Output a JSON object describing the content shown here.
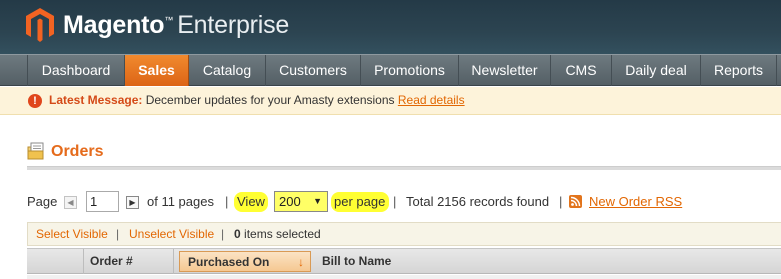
{
  "header": {
    "brand": "Magento",
    "trademark": "™",
    "edition": "Enterprise",
    "logo_icon": "magento-logo-icon"
  },
  "nav": {
    "items": [
      {
        "label": "Dashboard",
        "active": false
      },
      {
        "label": "Sales",
        "active": true
      },
      {
        "label": "Catalog",
        "active": false
      },
      {
        "label": "Customers",
        "active": false
      },
      {
        "label": "Promotions",
        "active": false
      },
      {
        "label": "Newsletter",
        "active": false
      },
      {
        "label": "CMS",
        "active": false
      },
      {
        "label": "Daily deal",
        "active": false
      },
      {
        "label": "Reports",
        "active": false
      }
    ],
    "active_color": "#e8731f"
  },
  "message": {
    "icon": "alert-icon",
    "label": "Latest Message:",
    "text": "December updates for your Amasty extensions",
    "link": "Read details"
  },
  "page": {
    "title": "Orders",
    "title_icon": "orders-icon",
    "title_color": "#e56b1c"
  },
  "pager": {
    "page_label": "Page",
    "prev_icon": "prev-arrow-icon",
    "current_page": "1",
    "next_icon": "next-arrow-icon",
    "of_pages": "of 11 pages",
    "separator": "|",
    "view_label": "View",
    "per_page_value": "200",
    "per_page_label": "per page",
    "total_records": "Total 2156 records found",
    "rss_icon": "rss-icon",
    "rss_link": "New Order RSS",
    "highlight_color": "#ffff33"
  },
  "massaction": {
    "select_visible": "Select Visible",
    "unselect_visible": "Unselect Visible",
    "separator": "|",
    "count": "0",
    "count_suffix": "items selected"
  },
  "grid": {
    "columns": [
      {
        "label": ""
      },
      {
        "label": "Order #"
      },
      {
        "label": "Purchased On",
        "sorted": true,
        "sort_icon": "sort-desc-arrow-icon"
      },
      {
        "label": "Bill to Name"
      }
    ]
  }
}
